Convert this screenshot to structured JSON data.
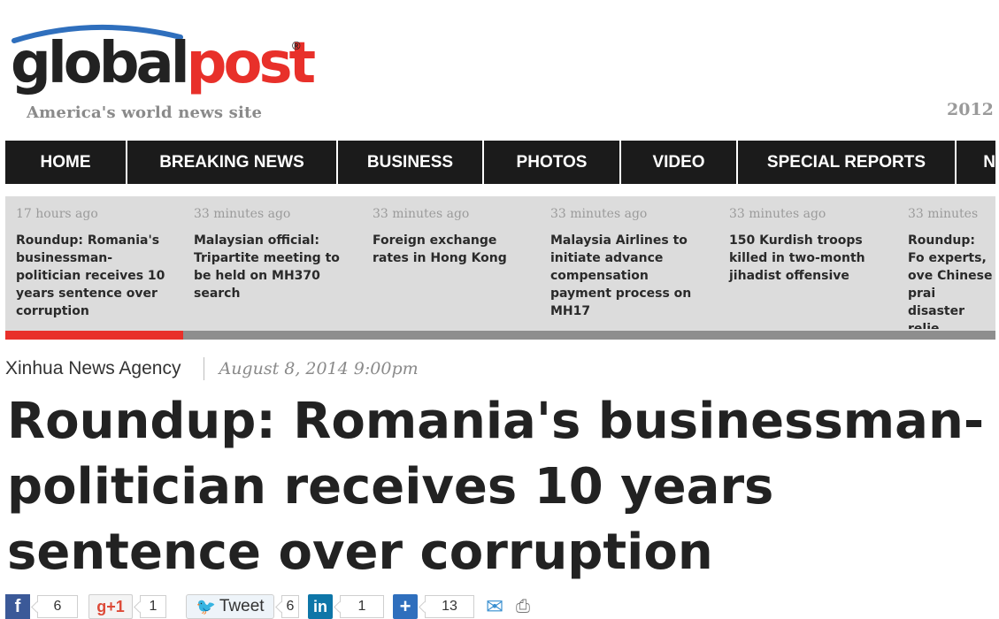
{
  "header": {
    "logo": {
      "part1": "global",
      "part2": "post",
      "registered": "®"
    },
    "tagline": "America's world news site",
    "right_text": "2012 A"
  },
  "nav": {
    "items": [
      {
        "label": "HOME"
      },
      {
        "label": "BREAKING NEWS"
      },
      {
        "label": "BUSINESS"
      },
      {
        "label": "PHOTOS"
      },
      {
        "label": "VIDEO"
      },
      {
        "label": "SPECIAL REPORTS"
      },
      {
        "label": "N"
      }
    ]
  },
  "ticker": {
    "items": [
      {
        "time": "17 hours ago",
        "headline": "Roundup: Romania's businessman-politician receives 10 years sentence over corruption"
      },
      {
        "time": "33 minutes ago",
        "headline": "Malaysian official: Tripartite meeting to be held on MH370 search"
      },
      {
        "time": "33 minutes ago",
        "headline": "Foreign exchange rates in Hong Kong"
      },
      {
        "time": "33 minutes ago",
        "headline": "Malaysia Airlines to initiate advance compensation payment process on MH17"
      },
      {
        "time": "33 minutes ago",
        "headline": "150 Kurdish troops killed in two-month jihadist offensive"
      },
      {
        "time": "33 minutes",
        "headline": "Roundup: Fo experts, ove Chinese prai disaster relie"
      }
    ],
    "progress": 0.18
  },
  "article": {
    "source": "Xinhua News Agency",
    "date": "August 8, 2014 9:00pm",
    "headline": "Roundup: Romania's businessman-politician receives 10 years sentence over corruption"
  },
  "share": {
    "facebook_icon": "f",
    "facebook_count": "6",
    "gplus_label": "g+1",
    "gplus_count": "1",
    "tweet_label": "Tweet",
    "tweet_count": "6",
    "linkedin_icon": "in",
    "linkedin_count": "1",
    "addthis_icon": "+",
    "addthis_count": "13"
  },
  "colors": {
    "brand_red": "#e8302a",
    "nav_bg": "#1b1b1b",
    "ticker_bg": "#dcdcdc",
    "arc_blue": "#2f6fbd"
  }
}
